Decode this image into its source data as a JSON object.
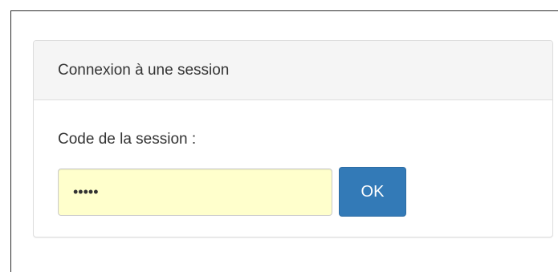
{
  "panel": {
    "heading": "Connexion à une session",
    "label": "Code de la session :",
    "input_value": "•••••",
    "ok_label": "OK"
  },
  "colors": {
    "primary_button": "#337ab7",
    "input_background": "#ffffcc",
    "heading_background": "#f5f5f5"
  }
}
